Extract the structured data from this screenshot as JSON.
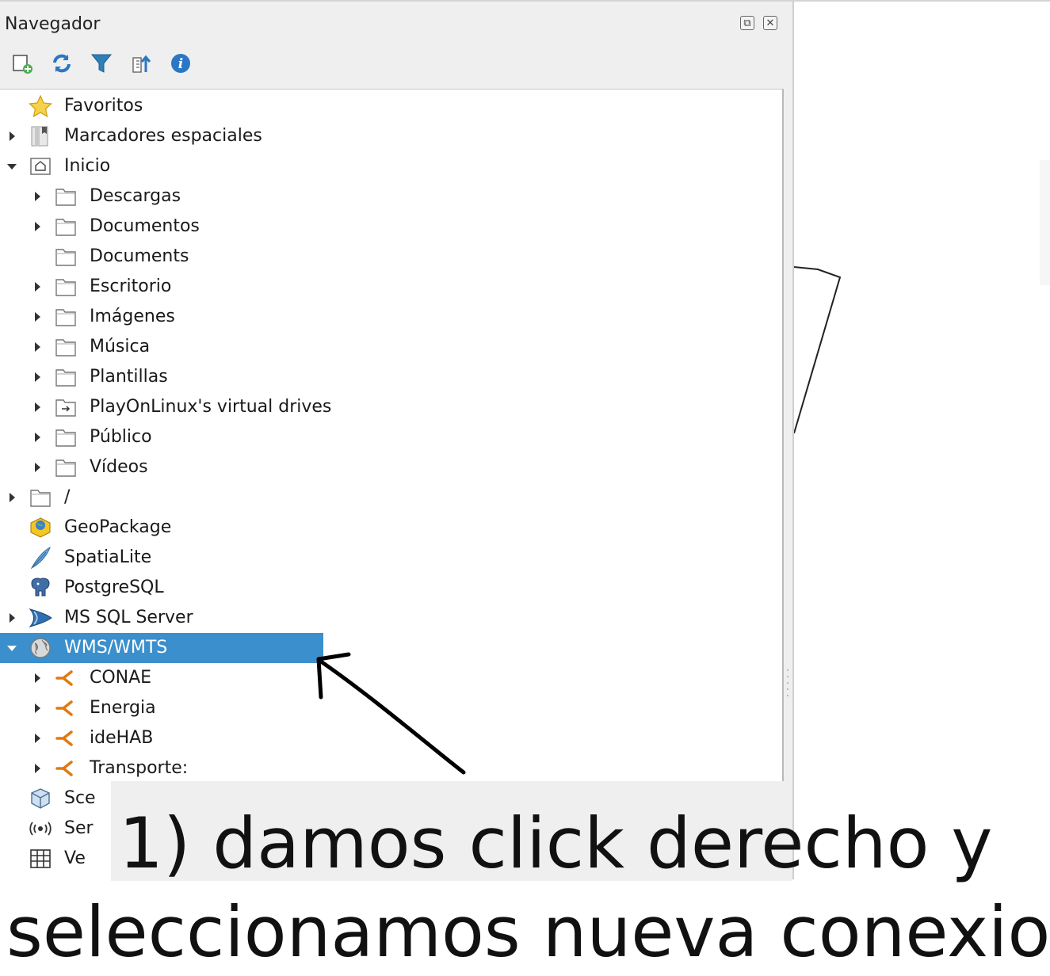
{
  "panel": {
    "title": "Navegador",
    "toolbar": [
      "add-layer-icon",
      "refresh-icon",
      "filter-icon",
      "collapse-icon",
      "info-icon"
    ]
  },
  "tree": [
    {
      "label": "Favoritos",
      "level": 0,
      "arrow": "none",
      "icon": "star-icon"
    },
    {
      "label": "Marcadores espaciales",
      "level": 0,
      "arrow": "right",
      "icon": "bookmark-icon"
    },
    {
      "label": "Inicio",
      "level": 0,
      "arrow": "down",
      "icon": "home-folder-icon"
    },
    {
      "label": "Descargas",
      "level": 1,
      "arrow": "right",
      "icon": "folder-icon"
    },
    {
      "label": "Documentos",
      "level": 1,
      "arrow": "right",
      "icon": "folder-icon"
    },
    {
      "label": "Documents",
      "level": 1,
      "arrow": "none",
      "icon": "folder-icon"
    },
    {
      "label": "Escritorio",
      "level": 1,
      "arrow": "right",
      "icon": "folder-icon"
    },
    {
      "label": "Imágenes",
      "level": 1,
      "arrow": "right",
      "icon": "folder-icon"
    },
    {
      "label": "Música",
      "level": 1,
      "arrow": "right",
      "icon": "folder-icon"
    },
    {
      "label": "Plantillas",
      "level": 1,
      "arrow": "right",
      "icon": "folder-icon"
    },
    {
      "label": "PlayOnLinux's virtual drives",
      "level": 1,
      "arrow": "right",
      "icon": "folder-link-icon"
    },
    {
      "label": "Público",
      "level": 1,
      "arrow": "right",
      "icon": "folder-icon"
    },
    {
      "label": "Vídeos",
      "level": 1,
      "arrow": "right",
      "icon": "folder-icon"
    },
    {
      "label": "/",
      "level": 0,
      "arrow": "right",
      "icon": "folder-icon"
    },
    {
      "label": "GeoPackage",
      "level": 0,
      "arrow": "none",
      "icon": "geopackage-icon"
    },
    {
      "label": "SpatiaLite",
      "level": 0,
      "arrow": "none",
      "icon": "feather-icon"
    },
    {
      "label": "PostgreSQL",
      "level": 0,
      "arrow": "none",
      "icon": "elephant-icon"
    },
    {
      "label": "MS SQL Server",
      "level": 0,
      "arrow": "right",
      "icon": "mssql-icon"
    },
    {
      "label": "WMS/WMTS",
      "level": 0,
      "arrow": "down",
      "icon": "globe-icon",
      "selected": true
    },
    {
      "label": "CONAE",
      "level": 1,
      "arrow": "right",
      "icon": "connection-icon"
    },
    {
      "label": "Energia",
      "level": 1,
      "arrow": "right",
      "icon": "connection-icon"
    },
    {
      "label": "ideHAB",
      "level": 1,
      "arrow": "right",
      "icon": "connection-icon"
    },
    {
      "label": "Transporte:",
      "level": 1,
      "arrow": "right",
      "icon": "connection-icon"
    }
  ],
  "tree_partial": [
    {
      "label": "Sce",
      "icon": "cube-icon"
    },
    {
      "label": "Ser",
      "icon": "wifi-icon"
    },
    {
      "label": "Ve",
      "icon": "grid-icon"
    }
  ],
  "annotation": {
    "line1": "1) damos click derecho y",
    "line2": "seleccionamos nueva conexion"
  },
  "colors": {
    "selection": "#3a8fcc",
    "panel_bg": "#efefef"
  }
}
